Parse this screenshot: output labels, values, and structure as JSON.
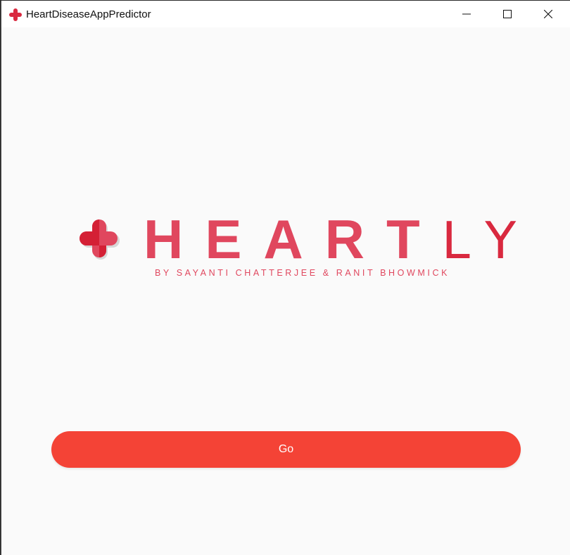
{
  "window": {
    "title": "HeartDiseaseAppPredictor",
    "controls": [
      "minimize-icon",
      "maximize-icon",
      "close-icon"
    ]
  },
  "logo": {
    "brand_bold": "HEART",
    "brand_light": "LY",
    "tagline": "BY SAYANTI CHATTERJEE & RANIT BHOWMICK",
    "icon": "medical-cross-icon"
  },
  "actions": {
    "go_label": "Go"
  },
  "colors": {
    "brand": "#e0475e",
    "brand_dark": "#d9293f",
    "button": "#f44336",
    "background": "#fafafa"
  }
}
